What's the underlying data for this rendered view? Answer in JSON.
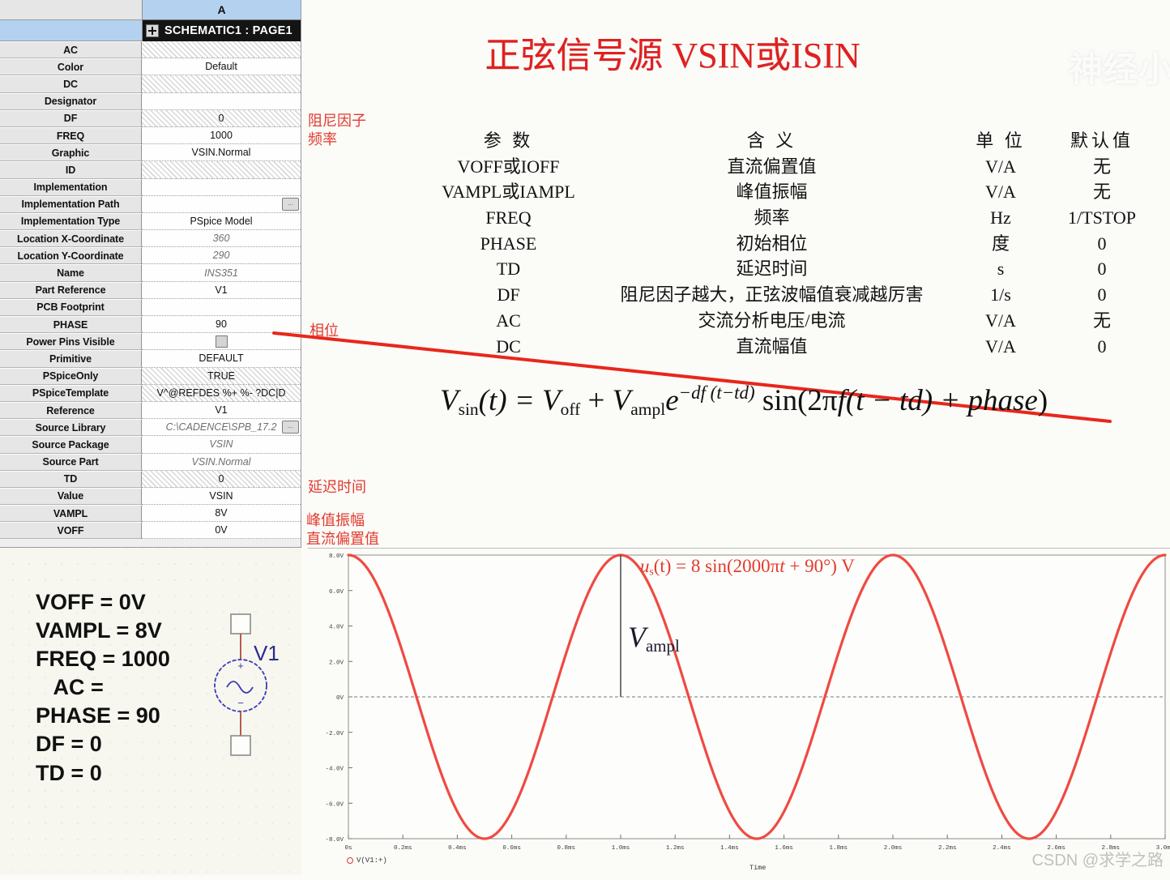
{
  "title": "正弦信号源 VSIN或ISIN",
  "watermark_top": "神经小",
  "watermark_bottom": "CSDN @求学之路",
  "property_editor": {
    "column_header": "A",
    "schematic_title": "SCHEMATIC1 : PAGE1",
    "rows": [
      {
        "name": "AC",
        "value": "",
        "style": "hatch"
      },
      {
        "name": "Color",
        "value": "Default",
        "style": "plain"
      },
      {
        "name": "DC",
        "value": "",
        "style": "hatch"
      },
      {
        "name": "Designator",
        "value": "",
        "style": "plain"
      },
      {
        "name": "DF",
        "value": "0",
        "style": "hatch"
      },
      {
        "name": "FREQ",
        "value": "1000",
        "style": "plain"
      },
      {
        "name": "Graphic",
        "value": "VSIN.Normal",
        "style": "plain"
      },
      {
        "name": "ID",
        "value": "",
        "style": "hatch"
      },
      {
        "name": "Implementation",
        "value": "",
        "style": "plain"
      },
      {
        "name": "Implementation Path",
        "value": "",
        "style": "button"
      },
      {
        "name": "Implementation Type",
        "value": "PSpice Model",
        "style": "plain"
      },
      {
        "name": "Location X-Coordinate",
        "value": "360",
        "style": "italic"
      },
      {
        "name": "Location Y-Coordinate",
        "value": "290",
        "style": "italic"
      },
      {
        "name": "Name",
        "value": "INS351",
        "style": "italic"
      },
      {
        "name": "Part Reference",
        "value": "V1",
        "style": "plain"
      },
      {
        "name": "PCB Footprint",
        "value": "",
        "style": "plain"
      },
      {
        "name": "PHASE",
        "value": "90",
        "style": "plain"
      },
      {
        "name": "Power Pins Visible",
        "value": "",
        "style": "checkbox"
      },
      {
        "name": "Primitive",
        "value": "DEFAULT",
        "style": "plain"
      },
      {
        "name": "PSpiceOnly",
        "value": "TRUE",
        "style": "hatch"
      },
      {
        "name": "PSpiceTemplate",
        "value": "V^@REFDES %+ %- ?DC|D",
        "style": "hatch-clip"
      },
      {
        "name": "Reference",
        "value": "V1",
        "style": "plain"
      },
      {
        "name": "Source Library",
        "value": "C:\\CADENCE\\SPB_17.2",
        "style": "italic-button"
      },
      {
        "name": "Source Package",
        "value": "VSIN",
        "style": "italic"
      },
      {
        "name": "Source Part",
        "value": "VSIN.Normal",
        "style": "italic"
      },
      {
        "name": "TD",
        "value": "0",
        "style": "hatch"
      },
      {
        "name": "Value",
        "value": "VSIN",
        "style": "plain"
      },
      {
        "name": "VAMPL",
        "value": "8V",
        "style": "plain"
      },
      {
        "name": "VOFF",
        "value": "0V",
        "style": "plain"
      }
    ]
  },
  "annotations": {
    "damping_factor": "阻尼因子",
    "frequency": "频率",
    "phase": "相位",
    "delay_time": "延迟时间",
    "peak_amplitude": "峰值振幅",
    "dc_offset": "直流偏置值",
    "accent_color": "#e23b2e"
  },
  "param_table": {
    "headers": [
      "参 数",
      "含 义",
      "单 位",
      "默认值"
    ],
    "rows": [
      [
        "VOFF或IOFF",
        "直流偏置值",
        "V/A",
        "无"
      ],
      [
        "VAMPL或IAMPL",
        "峰值振幅",
        "V/A",
        "无"
      ],
      [
        "FREQ",
        "频率",
        "Hz",
        "1/TSTOP"
      ],
      [
        "PHASE",
        "初始相位",
        "度",
        "0"
      ],
      [
        "TD",
        "延迟时间",
        "s",
        "0"
      ],
      [
        "DF",
        "阻尼因子越大，正弦波幅值衰减越厉害",
        "1/s",
        "0"
      ],
      [
        "AC",
        "交流分析电压/电流",
        "V/A",
        "无"
      ],
      [
        "DC",
        "直流幅值",
        "V/A",
        "0"
      ]
    ]
  },
  "formula": {
    "lhs_v": "V",
    "lhs_sub": "sin",
    "lhs_t": "(t) =",
    "voff_v": "V",
    "voff_sub": "off",
    "plus": "+",
    "vampl_v": "V",
    "vampl_sub": "ampl",
    "e": "e",
    "e_exp": "−df (t−td)",
    "sin_part": "sin(2π",
    "f": "f",
    "arg": "(t − td) + ",
    "phase_italic": "phase",
    "close": ")"
  },
  "schematic": {
    "lines": [
      "VOFF = 0V",
      "VAMPL = 8V",
      "FREQ = 1000",
      "   AC =",
      "PHASE = 90",
      "DF = 0",
      "TD = 0"
    ],
    "ref_designator": "V1"
  },
  "plot": {
    "equation": "u",
    "equation_sub": "s",
    "equation_rest": "(t) = 8 sin(2000π",
    "equation_t": "t",
    "equation_tail": " + 90°) V",
    "vampl_label_v": "V",
    "vampl_label_sub": "ampl",
    "legend": "V(V1:+)",
    "time_label": "Time"
  },
  "chart_data": {
    "type": "line",
    "title": "",
    "xlabel": "Time",
    "ylabel": "",
    "series": [
      {
        "name": "V(V1:+)",
        "color": "#ef4a42",
        "expression": "8*cos(2*pi*1000*t)",
        "amplitude_v": 8,
        "frequency_hz": 1000,
        "phase_deg": 90,
        "offset_v": 0,
        "damping": 0,
        "delay_s": 0
      }
    ],
    "xlim_ms": [
      0,
      3.0
    ],
    "ylim_v": [
      -8,
      8
    ],
    "xticks_ms": [
      0,
      0.2,
      0.4,
      0.6,
      0.8,
      1.0,
      1.2,
      1.4,
      1.6,
      1.8,
      2.0,
      2.2,
      2.4,
      2.6,
      2.8,
      3.0
    ],
    "xtick_labels": [
      "0s",
      "0.2ms",
      "0.4ms",
      "0.6ms",
      "0.8ms",
      "1.0ms",
      "1.2ms",
      "1.4ms",
      "1.6ms",
      "1.8ms",
      "2.0ms",
      "2.2ms",
      "2.4ms",
      "2.6ms",
      "2.8ms",
      "3.0ms"
    ],
    "yticks_v": [
      8,
      6,
      4,
      2,
      0,
      -2,
      -4,
      -6,
      -8
    ],
    "ytick_labels": [
      "8.0V",
      "6.0V",
      "4.0V",
      "2.0V",
      "0V",
      "-2.0V",
      "-4.0V",
      "-6.0V",
      "-8.0V"
    ],
    "grid": false,
    "zero_line": true,
    "legend_position": "bottom-left",
    "annotations": [
      {
        "text": "Vampl",
        "type": "vertical-measure",
        "x_ms": 1.0,
        "y_from_v": 8,
        "y_to_v": 0
      }
    ]
  }
}
